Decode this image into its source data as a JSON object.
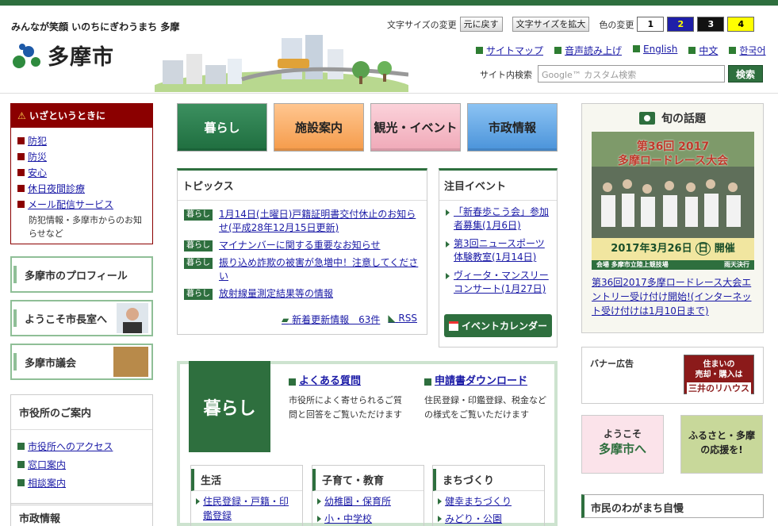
{
  "header": {
    "slogan": "みんなが笑顔 いのちにぎわうまち 多摩",
    "city_name": "多摩市",
    "text_size_label": "文字サイズの変更",
    "text_size_reset": "元に戻す",
    "text_size_enlarge": "文字サイズを拡大",
    "color_change_label": "色の変更",
    "color_options": [
      "1",
      "2",
      "3",
      "4"
    ],
    "links": [
      "サイトマップ",
      "音声読み上げ",
      "English",
      "中文",
      "한국어"
    ],
    "search_label": "サイト内検索",
    "search_placeholder": "Google™ カスタム検索",
    "search_button": "検索"
  },
  "emergency": {
    "title": "いざというときに",
    "items": [
      "防犯",
      "防災",
      "安心",
      "休日夜間診療",
      "メール配信サービス"
    ],
    "note": "防犯情報・多摩市からのお知らせなど"
  },
  "side_buttons": [
    "多摩市のプロフィール",
    "ようこそ市長室へ",
    "多摩市議会"
  ],
  "office": {
    "title": "市役所のご案内",
    "items": [
      "市役所へのアクセス",
      "窓口案内",
      "相談案内"
    ]
  },
  "city_info_title": "市政情報",
  "nav": [
    "暮らし",
    "施設案内",
    "観光・イベント",
    "市政情報"
  ],
  "topics": {
    "title": "トピックス",
    "tag": "暮らし",
    "items": [
      "1月14日(土曜日)戸籍証明書交付休止のお知らせ(平成28年12月15日更新)",
      "マイナンバーに関する重要なお知らせ",
      "振り込め詐欺の被害が急増中！注意してください",
      "放射線量測定結果等の情報"
    ],
    "new_info": "新着更新情報　63件",
    "rss": "RSS"
  },
  "events": {
    "title": "注目イベント",
    "items": [
      "「新春歩こう会」参加者募集(1月6日)",
      "第3回ニュースポーツ体験教室(1月14日)",
      "ヴィータ・マンスリーコンサート(1月27日)"
    ],
    "calendar": "イベントカレンダー"
  },
  "kurashi": {
    "tab": "暮らし",
    "faq_title": "よくある質問",
    "faq_desc": "市役所によく寄せられるご質問と回答をご覧いただけます",
    "dl_title": "申請書ダウンロード",
    "dl_desc": "住民登録・印鑑登録、税金などの様式をご覧いただけます",
    "categories": [
      {
        "title": "生活",
        "items": [
          "住民登録・戸籍・印鑑登録"
        ]
      },
      {
        "title": "子育て・教育",
        "items": [
          "幼稚園・保育所",
          "小・中学校"
        ]
      },
      {
        "title": "まちづくり",
        "items": [
          "健幸まちづくり",
          "みどり・公園"
        ]
      }
    ]
  },
  "shun": {
    "title": "旬の話題",
    "poster_line1": "第36回 2017",
    "poster_line2": "多摩ロードレース大会",
    "poster_date": "2017年3月26日",
    "poster_day": "日",
    "poster_open": "開催",
    "poster_venue": "会場 多摩市立陸上競技場",
    "poster_rain": "雨天決行",
    "caption": "第36回2017多摩ロードレース大会エントリー受け付け開始!(インターネット受け付けは1月10日まで)"
  },
  "banner": {
    "label": "バナー広告",
    "mitsui_line1": "住まいの",
    "mitsui_line2": "売却・購入は",
    "mitsui_brand": "三井のリハウス"
  },
  "yokoso": {
    "line1": "ようこそ",
    "line2": "多摩市へ"
  },
  "furusato": {
    "line1": "ふるさと・多摩",
    "line2": "の応援を!"
  },
  "jiman": "市民のわがまち自慢",
  "colors": {
    "primary": "#2e6f3e",
    "emergency": "#8b0000",
    "nav_kurashi": "#2e7d4f",
    "nav_shisetsu": "#f5a65b",
    "nav_kanko": "#f3b6c2",
    "nav_shisei": "#5c9fe0"
  }
}
